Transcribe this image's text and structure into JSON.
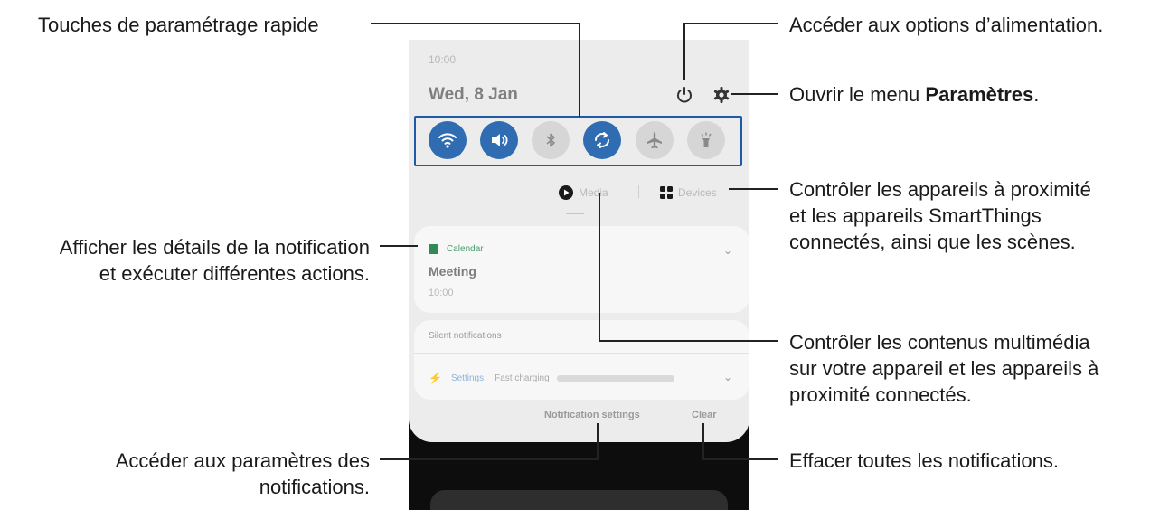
{
  "callouts": {
    "quick_settings": "Touches de paramétrage rapide",
    "power_options": "Accéder aux options d’alimentation.",
    "settings_menu_prefix": "Ouvrir le menu ",
    "settings_menu_bold": "Paramètres",
    "settings_menu_suffix": ".",
    "devices_line1": "Contrôler les appareils à proximité",
    "devices_line2": "et les appareils SmartThings",
    "devices_line3": "connectés, ainsi que les scènes.",
    "notif_details_line1": "Afficher les détails de la notification",
    "notif_details_line2": "et exécuter différentes actions.",
    "media_line1": "Contrôler les contenus multimédia",
    "media_line2": "sur votre appareil et les appareils à",
    "media_line3": "proximité connectés.",
    "notif_settings_line1": "Accéder aux paramètres des",
    "notif_settings_line2": "notifications.",
    "clear_all": "Effacer toutes les notifications."
  },
  "phone": {
    "time": "10:00",
    "date": "Wed, 8 Jan",
    "quick_settings": [
      {
        "icon": "wifi-icon",
        "state": "on"
      },
      {
        "icon": "sound-icon",
        "state": "on"
      },
      {
        "icon": "bluetooth-icon",
        "state": "off"
      },
      {
        "icon": "auto-rotate-icon",
        "state": "on"
      },
      {
        "icon": "airplane-icon",
        "state": "off"
      },
      {
        "icon": "flashlight-icon",
        "state": "off"
      }
    ],
    "media_label": "Media",
    "devices_label": "Devices",
    "notification": {
      "app": "Calendar",
      "title": "Meeting",
      "time": "10:00"
    },
    "silent_header": "Silent notifications",
    "silent_item": {
      "app": "Settings",
      "text": "Fast charging"
    },
    "notification_settings_label": "Notification settings",
    "clear_label": "Clear"
  },
  "colors": {
    "accent": "#2f6cb2",
    "highlight_box": "#1e5aa6",
    "panel_bg": "#ececec",
    "card_bg": "#f7f7f7"
  }
}
